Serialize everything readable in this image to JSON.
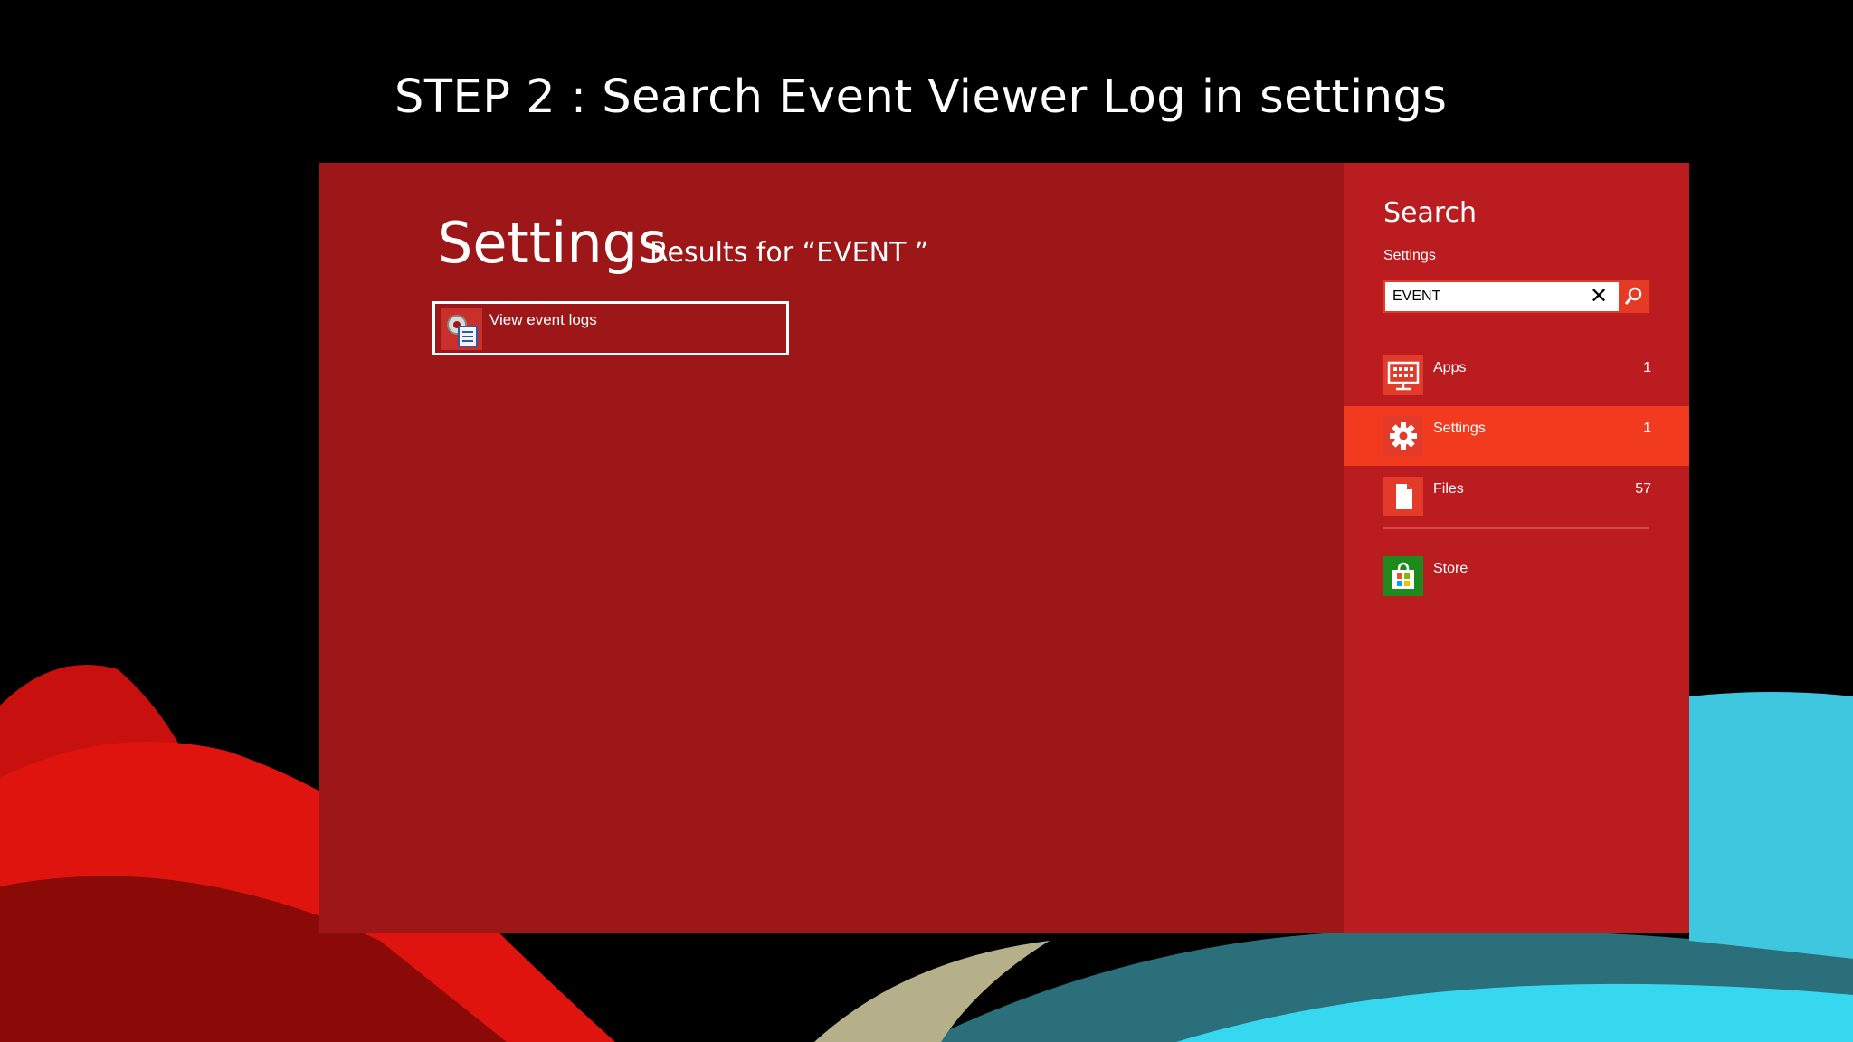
{
  "slide": {
    "title": "STEP 2 : Search Event Viewer Log in settings"
  },
  "results": {
    "heading": "Settings",
    "subheading": "Results for “EVENT ”",
    "items": [
      {
        "label": "View event logs",
        "icon": "event-viewer-icon"
      }
    ]
  },
  "search": {
    "title": "Search",
    "scope": "Settings",
    "query": "EVENT",
    "clear_icon": "close-icon",
    "go_icon": "search-icon",
    "categories": [
      {
        "label": "Apps",
        "count": "1",
        "icon": "apps-icon",
        "selected": false
      },
      {
        "label": "Settings",
        "count": "1",
        "icon": "gear-icon",
        "selected": true
      },
      {
        "label": "Files",
        "count": "57",
        "icon": "file-icon",
        "selected": false
      }
    ],
    "store": {
      "label": "Store",
      "icon": "store-icon"
    }
  },
  "colors": {
    "results_bg": "#9d1719",
    "search_bg": "#bb1c20",
    "selected_bg": "#f23a1f",
    "accent": "#e63a26",
    "store_green": "#1f8a1c"
  }
}
